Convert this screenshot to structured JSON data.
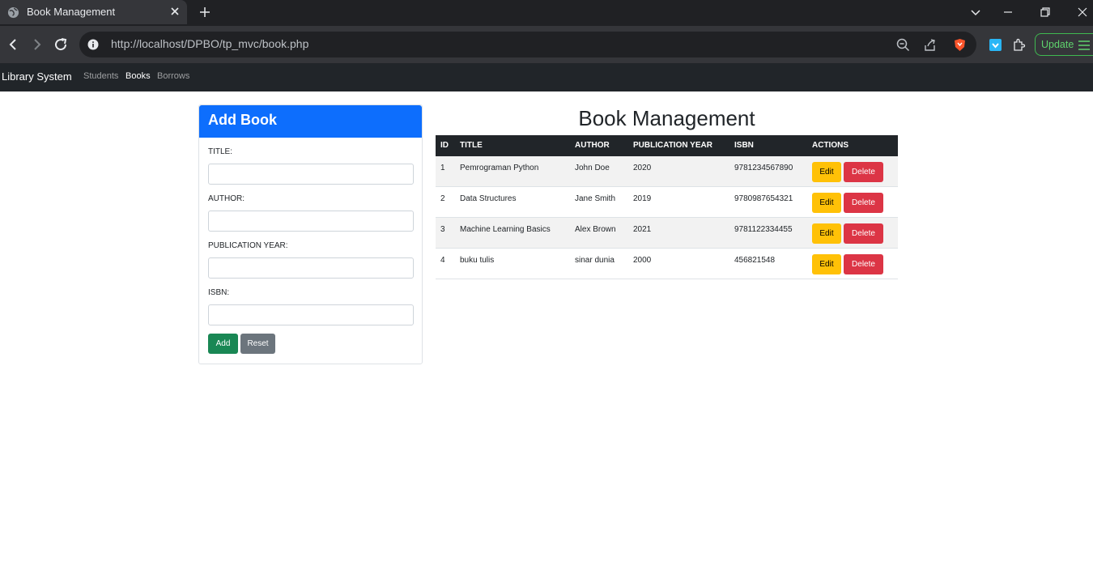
{
  "browser": {
    "tab_title": "Book Management",
    "url": "http://localhost/DPBO/tp_mvc/book.php",
    "update_label": "Update"
  },
  "nav": {
    "brand": "Library System",
    "links": [
      "Students",
      "Books",
      "Borrows"
    ],
    "active": "Books"
  },
  "form": {
    "title": "Add Book",
    "fields": [
      {
        "label": "TITLE:",
        "value": ""
      },
      {
        "label": "AUTHOR:",
        "value": ""
      },
      {
        "label": "PUBLICATION YEAR:",
        "value": ""
      },
      {
        "label": "ISBN:",
        "value": ""
      }
    ],
    "add_label": "Add",
    "reset_label": "Reset"
  },
  "table": {
    "heading": "Book Management",
    "columns": [
      "ID",
      "TITLE",
      "AUTHOR",
      "PUBLICATION YEAR",
      "ISBN",
      "ACTIONS"
    ],
    "rows": [
      {
        "id": "1",
        "title": "Pemrograman Python",
        "author": "John Doe",
        "year": "2020",
        "isbn": "9781234567890"
      },
      {
        "id": "2",
        "title": "Data Structures",
        "author": "Jane Smith",
        "year": "2019",
        "isbn": "9780987654321"
      },
      {
        "id": "3",
        "title": "Machine Learning Basics",
        "author": "Alex Brown",
        "year": "2021",
        "isbn": "9781122334455"
      },
      {
        "id": "4",
        "title": "buku tulis",
        "author": "sinar dunia",
        "year": "2000",
        "isbn": "456821548"
      }
    ],
    "edit_label": "Edit",
    "delete_label": "Delete"
  },
  "colors": {
    "primary": "#0d6efd",
    "success": "#198754",
    "secondary": "#6c757d",
    "warning": "#ffc107",
    "danger": "#dc3545",
    "dark": "#212529"
  }
}
